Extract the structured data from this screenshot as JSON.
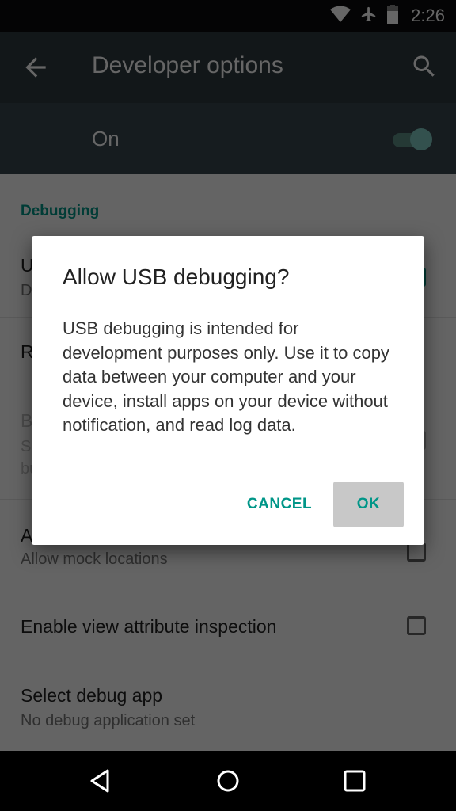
{
  "status_bar": {
    "time": "2:26",
    "icons": [
      "wifi-icon",
      "airplane-mode-icon",
      "battery-icon"
    ]
  },
  "app_bar": {
    "title": "Developer options",
    "back_icon": "arrow-back-icon",
    "search_icon": "search-icon"
  },
  "master_switch": {
    "label": "On",
    "checked": true
  },
  "settings": {
    "section_header": "Debugging",
    "rows": [
      {
        "title": "USB debugging",
        "subtitle": "Debug mode when USB is connected",
        "control": "checkbox",
        "checked": true
      },
      {
        "title": "Revoke USB debugging authorizations",
        "subtitle": "",
        "control": "none"
      },
      {
        "title": "Bug report shortcut",
        "subtitle": "Show a button in the power menu for taking a bug report",
        "control": "checkbox",
        "disabled": true
      },
      {
        "title": "Allow mock locations",
        "subtitle": "Allow mock locations",
        "control": "checkbox",
        "checked": false
      },
      {
        "title": "Enable view attribute inspection",
        "subtitle": "",
        "control": "checkbox",
        "checked": false
      },
      {
        "title": "Select debug app",
        "subtitle": "No debug application set",
        "control": "none"
      }
    ]
  },
  "dialog": {
    "title": "Allow USB debugging?",
    "body": "USB debugging is intended for development purposes only. Use it to copy data between your computer and your device, install apps on your device without notification, and read log data.",
    "cancel_label": "CANCEL",
    "ok_label": "OK"
  },
  "nav_bar": {
    "buttons": [
      "back-icon",
      "home-icon",
      "recents-icon"
    ]
  },
  "colors": {
    "accent": "#009688",
    "app_bar": "#2e3a3f",
    "switch_bar": "#37474f"
  }
}
